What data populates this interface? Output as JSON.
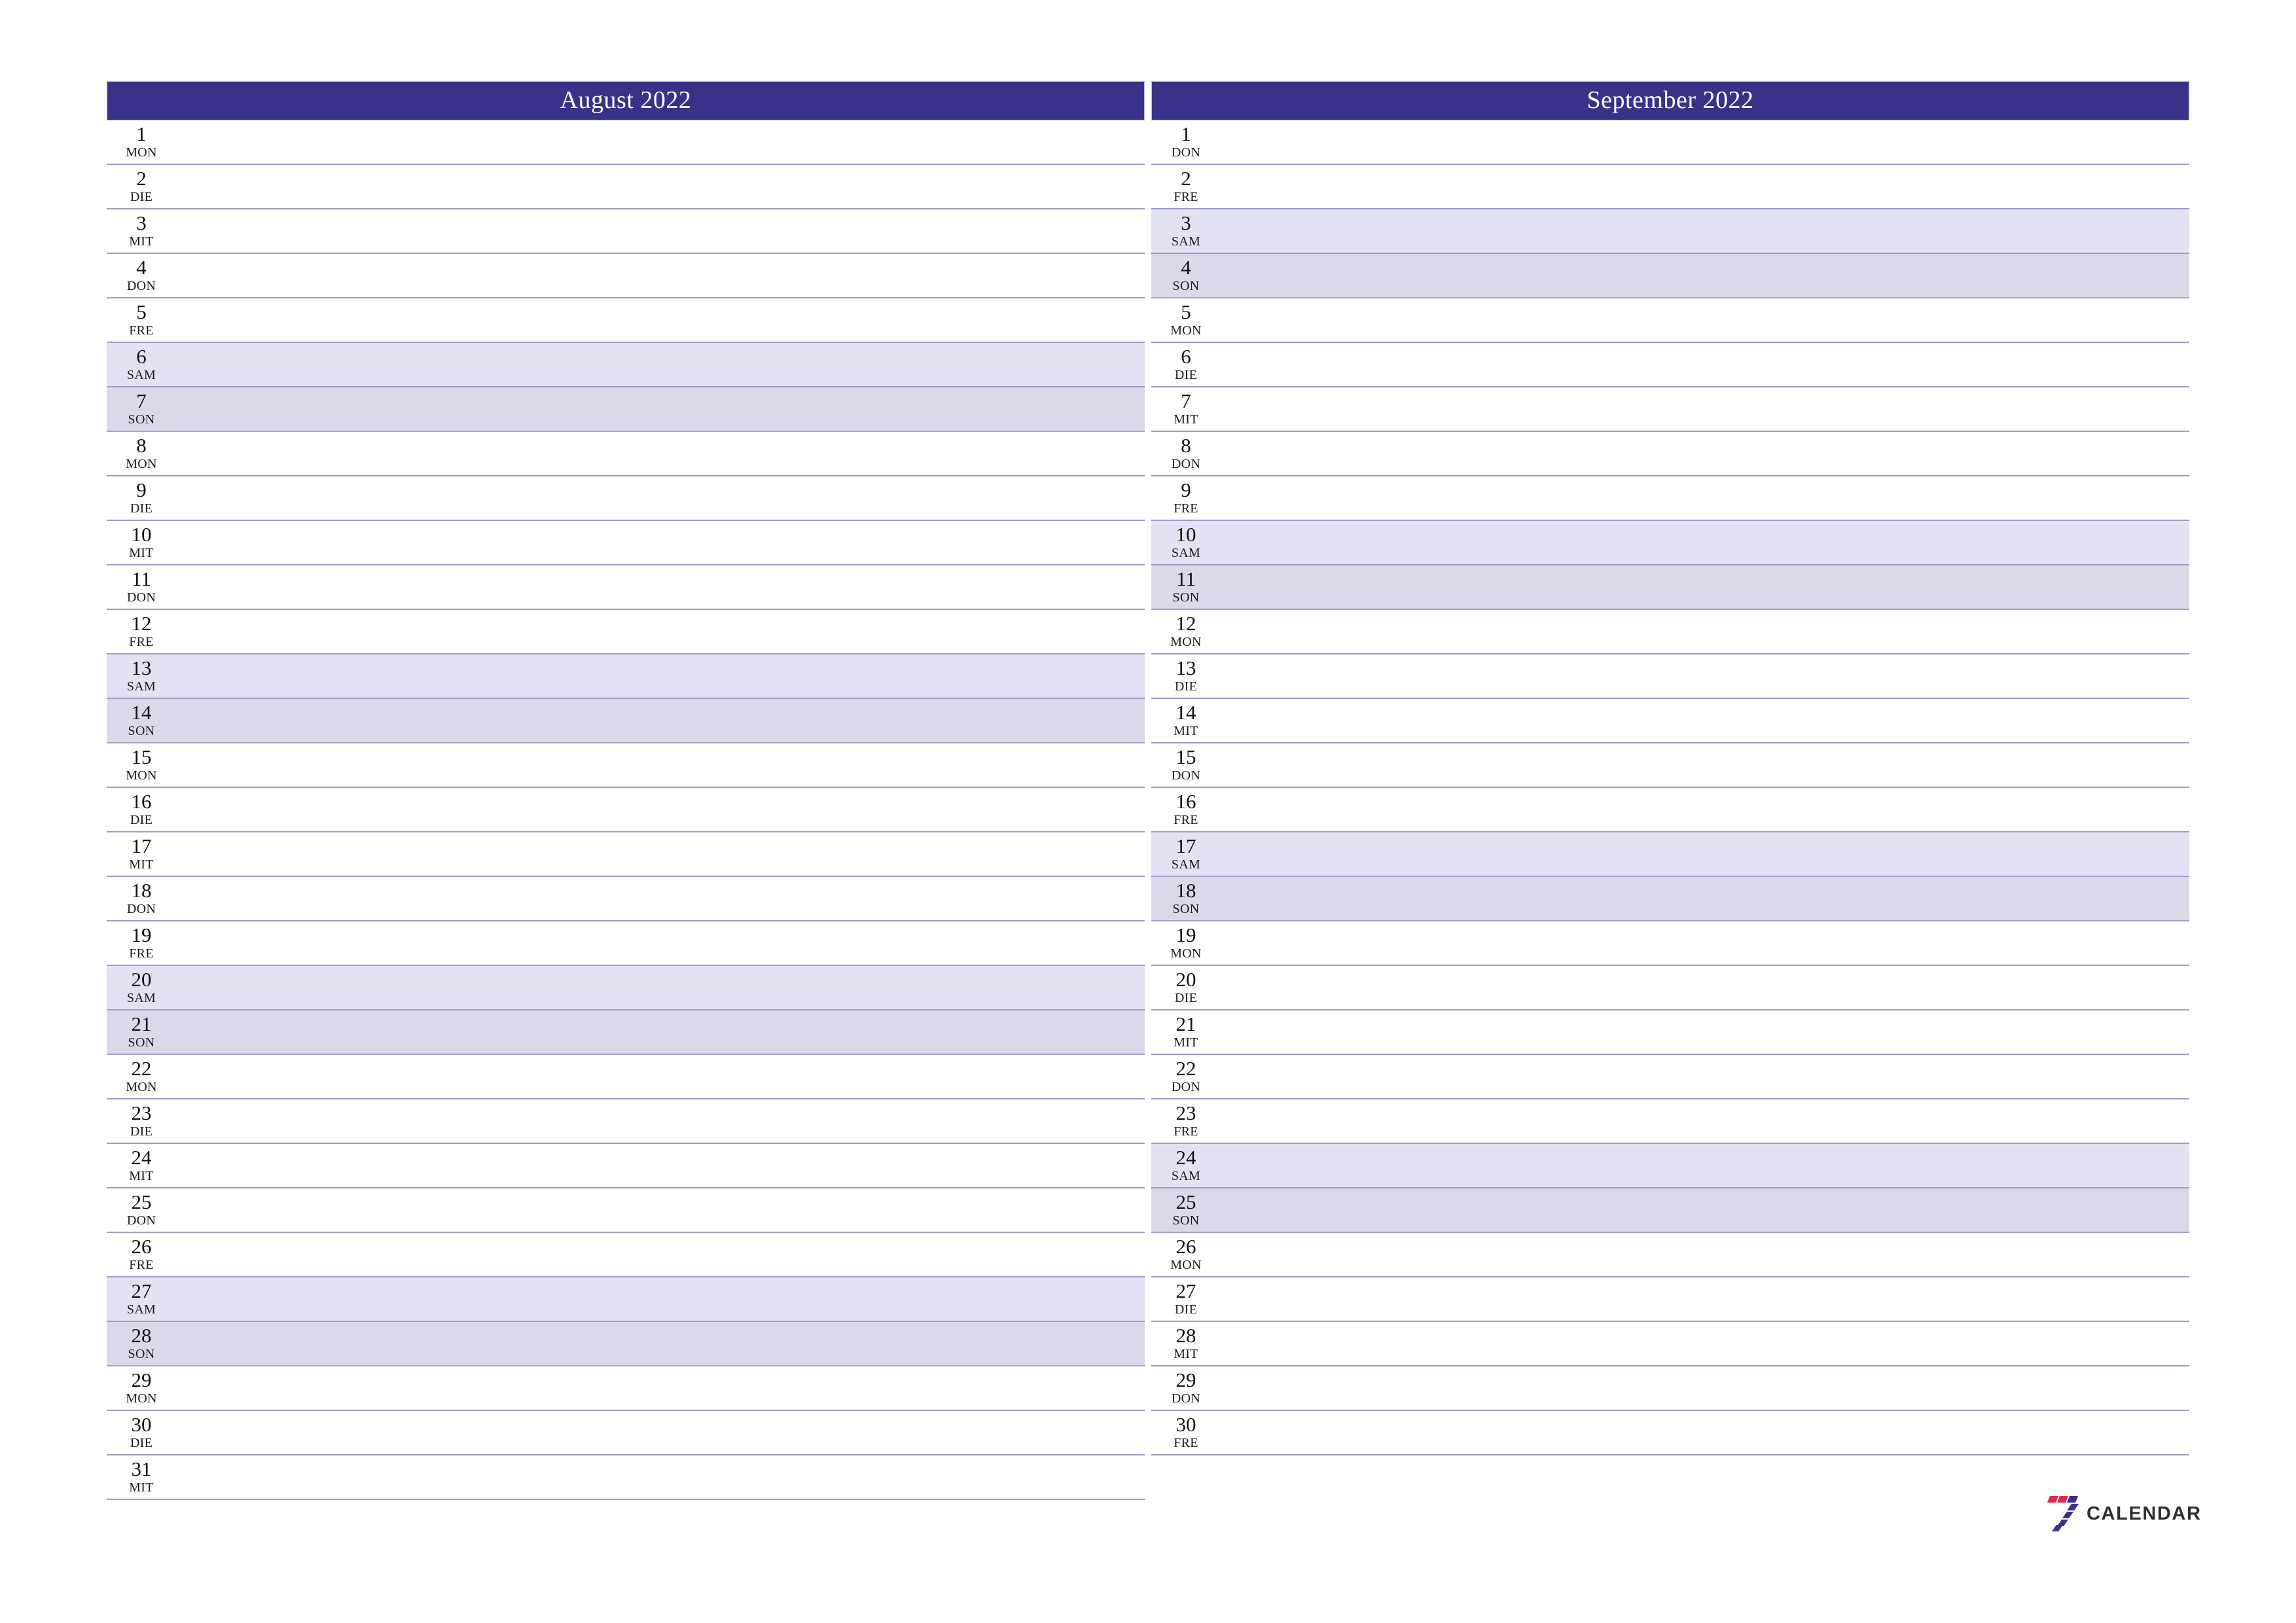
{
  "document": {
    "type": "two-month-planner",
    "year": "2022",
    "locale_day_abbrs": [
      "MON",
      "DIE",
      "MIT",
      "DON",
      "FRE",
      "SAM",
      "SON"
    ],
    "page_background": "#ffffff"
  },
  "colors": {
    "header_bar": "#3a3288",
    "header_text": "#ffffff",
    "row_line": "#9e9bc4",
    "saturday_bg": "#e3e2f4",
    "sunday_bg": "#dcd8ea",
    "logo_red": "#e8274b",
    "logo_navy": "#3a3288",
    "logo_word": "#2f2f2f"
  },
  "months": [
    {
      "key": "august",
      "title": "August 2022",
      "days": [
        {
          "num": "1",
          "abbr": "MON",
          "kind": "weekday"
        },
        {
          "num": "2",
          "abbr": "DIE",
          "kind": "weekday"
        },
        {
          "num": "3",
          "abbr": "MIT",
          "kind": "weekday"
        },
        {
          "num": "4",
          "abbr": "DON",
          "kind": "weekday"
        },
        {
          "num": "5",
          "abbr": "FRE",
          "kind": "weekday"
        },
        {
          "num": "6",
          "abbr": "SAM",
          "kind": "sat"
        },
        {
          "num": "7",
          "abbr": "SON",
          "kind": "sun"
        },
        {
          "num": "8",
          "abbr": "MON",
          "kind": "weekday"
        },
        {
          "num": "9",
          "abbr": "DIE",
          "kind": "weekday"
        },
        {
          "num": "10",
          "abbr": "MIT",
          "kind": "weekday"
        },
        {
          "num": "11",
          "abbr": "DON",
          "kind": "weekday"
        },
        {
          "num": "12",
          "abbr": "FRE",
          "kind": "weekday"
        },
        {
          "num": "13",
          "abbr": "SAM",
          "kind": "sat"
        },
        {
          "num": "14",
          "abbr": "SON",
          "kind": "sun"
        },
        {
          "num": "15",
          "abbr": "MON",
          "kind": "weekday"
        },
        {
          "num": "16",
          "abbr": "DIE",
          "kind": "weekday"
        },
        {
          "num": "17",
          "abbr": "MIT",
          "kind": "weekday"
        },
        {
          "num": "18",
          "abbr": "DON",
          "kind": "weekday"
        },
        {
          "num": "19",
          "abbr": "FRE",
          "kind": "weekday"
        },
        {
          "num": "20",
          "abbr": "SAM",
          "kind": "sat"
        },
        {
          "num": "21",
          "abbr": "SON",
          "kind": "sun"
        },
        {
          "num": "22",
          "abbr": "MON",
          "kind": "weekday"
        },
        {
          "num": "23",
          "abbr": "DIE",
          "kind": "weekday"
        },
        {
          "num": "24",
          "abbr": "MIT",
          "kind": "weekday"
        },
        {
          "num": "25",
          "abbr": "DON",
          "kind": "weekday"
        },
        {
          "num": "26",
          "abbr": "FRE",
          "kind": "weekday"
        },
        {
          "num": "27",
          "abbr": "SAM",
          "kind": "sat"
        },
        {
          "num": "28",
          "abbr": "SON",
          "kind": "sun"
        },
        {
          "num": "29",
          "abbr": "MON",
          "kind": "weekday"
        },
        {
          "num": "30",
          "abbr": "DIE",
          "kind": "weekday"
        },
        {
          "num": "31",
          "abbr": "MIT",
          "kind": "weekday"
        }
      ]
    },
    {
      "key": "september",
      "title": "September 2022",
      "days": [
        {
          "num": "1",
          "abbr": "DON",
          "kind": "weekday"
        },
        {
          "num": "2",
          "abbr": "FRE",
          "kind": "weekday"
        },
        {
          "num": "3",
          "abbr": "SAM",
          "kind": "sat"
        },
        {
          "num": "4",
          "abbr": "SON",
          "kind": "sun"
        },
        {
          "num": "5",
          "abbr": "MON",
          "kind": "weekday"
        },
        {
          "num": "6",
          "abbr": "DIE",
          "kind": "weekday"
        },
        {
          "num": "7",
          "abbr": "MIT",
          "kind": "weekday"
        },
        {
          "num": "8",
          "abbr": "DON",
          "kind": "weekday"
        },
        {
          "num": "9",
          "abbr": "FRE",
          "kind": "weekday"
        },
        {
          "num": "10",
          "abbr": "SAM",
          "kind": "sat"
        },
        {
          "num": "11",
          "abbr": "SON",
          "kind": "sun"
        },
        {
          "num": "12",
          "abbr": "MON",
          "kind": "weekday"
        },
        {
          "num": "13",
          "abbr": "DIE",
          "kind": "weekday"
        },
        {
          "num": "14",
          "abbr": "MIT",
          "kind": "weekday"
        },
        {
          "num": "15",
          "abbr": "DON",
          "kind": "weekday"
        },
        {
          "num": "16",
          "abbr": "FRE",
          "kind": "weekday"
        },
        {
          "num": "17",
          "abbr": "SAM",
          "kind": "sat"
        },
        {
          "num": "18",
          "abbr": "SON",
          "kind": "sun"
        },
        {
          "num": "19",
          "abbr": "MON",
          "kind": "weekday"
        },
        {
          "num": "20",
          "abbr": "DIE",
          "kind": "weekday"
        },
        {
          "num": "21",
          "abbr": "MIT",
          "kind": "weekday"
        },
        {
          "num": "22",
          "abbr": "DON",
          "kind": "weekday"
        },
        {
          "num": "23",
          "abbr": "FRE",
          "kind": "weekday"
        },
        {
          "num": "24",
          "abbr": "SAM",
          "kind": "sat"
        },
        {
          "num": "25",
          "abbr": "SON",
          "kind": "sun"
        },
        {
          "num": "26",
          "abbr": "MON",
          "kind": "weekday"
        },
        {
          "num": "27",
          "abbr": "DIE",
          "kind": "weekday"
        },
        {
          "num": "28",
          "abbr": "MIT",
          "kind": "weekday"
        },
        {
          "num": "29",
          "abbr": "DON",
          "kind": "weekday"
        },
        {
          "num": "30",
          "abbr": "FRE",
          "kind": "weekday"
        }
      ]
    }
  ],
  "logo": {
    "mark": "seven-logo-icon",
    "word": "CALENDAR"
  }
}
